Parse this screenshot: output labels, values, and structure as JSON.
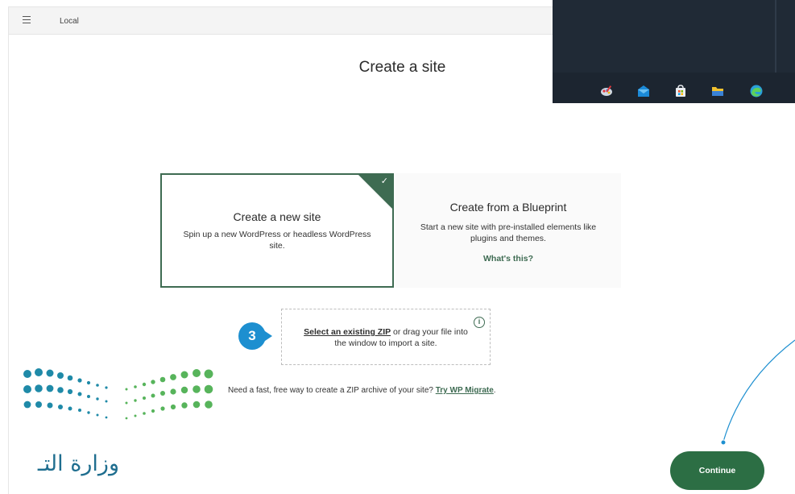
{
  "app": {
    "title": "Local"
  },
  "page": {
    "title": "Create a site"
  },
  "cards": {
    "new_site": {
      "title": "Create a new site",
      "description": "Spin up a new WordPress or headless WordPress site.",
      "check": "✓"
    },
    "blueprint": {
      "title": "Create from a Blueprint",
      "description": "Start a new site with pre-installed elements like plugins and themes.",
      "link": "What's this?"
    }
  },
  "zip": {
    "link": "Select an existing ZIP",
    "text": " or drag your file into the window to import a site.",
    "info_icon": "i"
  },
  "migrate": {
    "text": "Need a fast, free way to create a ZIP archive of your site? ",
    "link": "Try WP Migrate",
    "suffix": "."
  },
  "step_badge": {
    "number": "3"
  },
  "continue_button": {
    "label": "Continue"
  },
  "ministry": {
    "text": "وزارة التـ"
  },
  "taskbar": {
    "icons": [
      "paint-icon",
      "mail-icon",
      "store-icon",
      "file-explorer-icon",
      "edge-browser-icon"
    ]
  },
  "colors": {
    "accent_green": "#3e6b52",
    "button_green": "#2c6e44",
    "badge_blue": "#1d8fd0",
    "logo_teal": "#1f8aa8",
    "logo_green": "#57b45b"
  }
}
